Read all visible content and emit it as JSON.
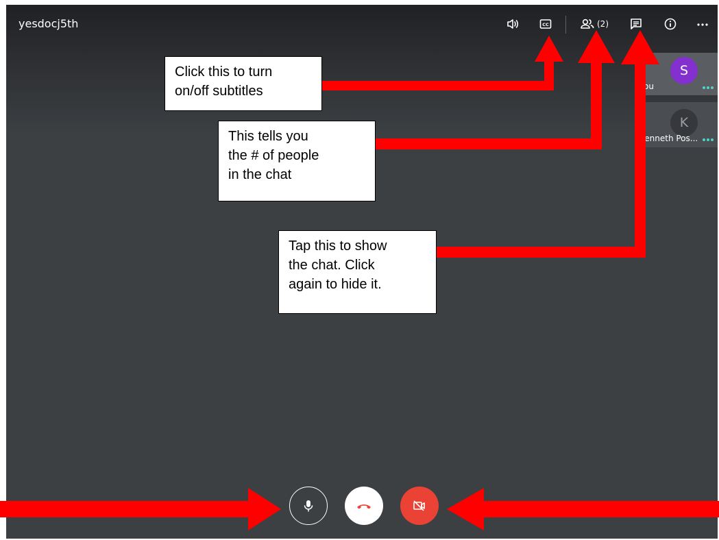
{
  "meeting": {
    "code": "yesdocj5th"
  },
  "topbar": {
    "volume_icon": "volume-icon",
    "captions_icon": "closed-captions-icon",
    "people_icon": "people-icon",
    "people_count": "(2)",
    "chat_icon": "chat-icon",
    "info_icon": "info-icon",
    "more_icon": "more-options-icon"
  },
  "participants": [
    {
      "initial": "S",
      "name": "ou",
      "avatar_color": "#8430ce"
    },
    {
      "initial": "K",
      "name": "Kenneth Pos...",
      "avatar_color": "#3c4043"
    }
  ],
  "controls": {
    "mic_icon": "microphone-icon",
    "end_call_icon": "phone-hangup-icon",
    "camera_icon": "camera-off-icon",
    "end_call_color": "#ffffff",
    "camera_color": "#ea4335"
  },
  "callouts": {
    "subtitles": [
      "Click this to turn",
      "on/off subtitles"
    ],
    "people": [
      "This tells you",
      "the # of people",
      "in the chat"
    ],
    "chat": [
      "Tap this to show",
      "the chat. Click",
      "again to hide it."
    ]
  },
  "colors": {
    "arrow": "#ff0000",
    "background": "#3c4043"
  }
}
